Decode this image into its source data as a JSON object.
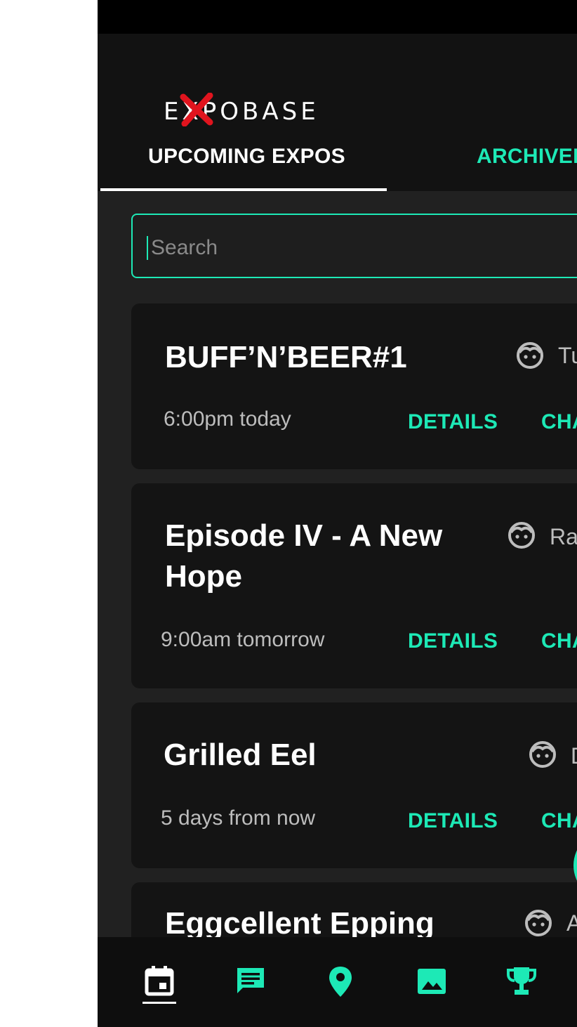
{
  "app": {
    "logo_text": "EXPOBASE",
    "accent_color": "#1de9b6",
    "logo_x_color": "#e0141e"
  },
  "tabs": [
    {
      "label": "UPCOMING EXPOS",
      "active": true
    },
    {
      "label": "ARCHIVED",
      "active": false
    }
  ],
  "search": {
    "placeholder": "Search",
    "value": ""
  },
  "expos": [
    {
      "title": "BUFF’N’BEER#1",
      "host": "Tu",
      "time": "6:00pm today",
      "details_label": "DETAILS",
      "chat_label": "CHA"
    },
    {
      "title": "Episode IV - A New Hope",
      "host": "Ra",
      "time": "9:00am tomorrow",
      "details_label": "DETAILS",
      "chat_label": "CHA"
    },
    {
      "title": "Grilled Eel",
      "host": "D",
      "time": "5 days from now",
      "details_label": "DETAILS",
      "chat_label": "CHA"
    },
    {
      "title": "Eggcellent Epping",
      "host": "A",
      "time": "",
      "details_label": "",
      "chat_label": ""
    }
  ],
  "bottom_nav": [
    {
      "icon": "calendar-icon",
      "active": true
    },
    {
      "icon": "chat-icon",
      "active": false
    },
    {
      "icon": "location-pin-icon",
      "active": false
    },
    {
      "icon": "image-icon",
      "active": false
    },
    {
      "icon": "trophy-icon",
      "active": false
    }
  ]
}
